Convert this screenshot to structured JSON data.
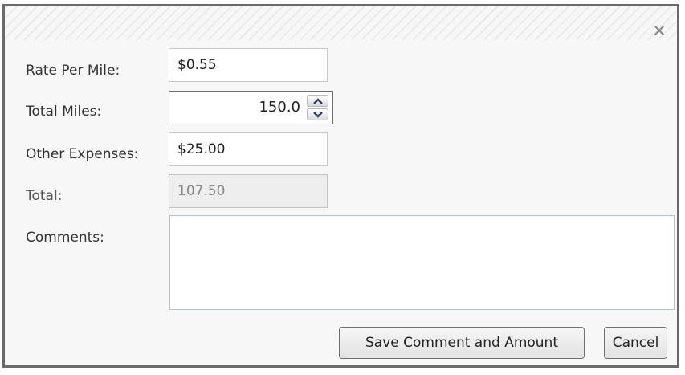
{
  "dialog": {
    "close_icon": "close-icon",
    "fields": {
      "rate_per_mile": {
        "label": "Rate Per Mile:",
        "value": "$0.55"
      },
      "total_miles": {
        "label": "Total Miles:",
        "value": "150.0",
        "spin_up_icon": "chevron-up-icon",
        "spin_down_icon": "chevron-down-icon"
      },
      "other_expenses": {
        "label": "Other Expenses:",
        "value": "$25.00"
      },
      "total": {
        "label": "Total:",
        "value": "107.50"
      },
      "comments": {
        "label": "Comments:",
        "value": ""
      }
    },
    "buttons": {
      "save_label": "Save Comment and Amount",
      "cancel_label": "Cancel"
    }
  }
}
